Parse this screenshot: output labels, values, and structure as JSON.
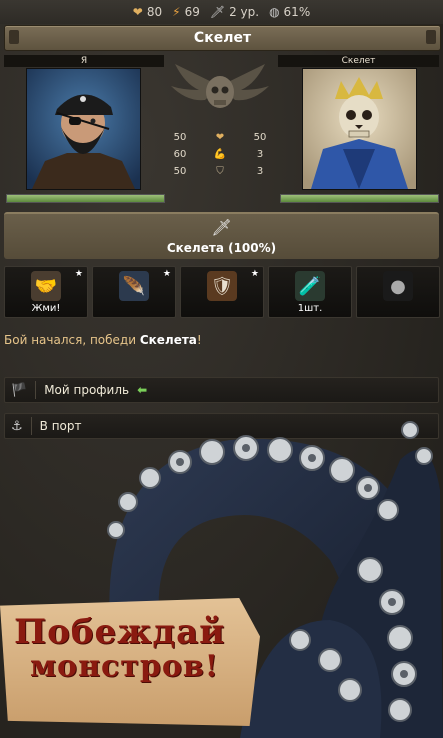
{
  "stats": {
    "health": "80",
    "energy": "69",
    "level": "2 ур.",
    "progress": "61%"
  },
  "title": "Скелет",
  "player": {
    "name": "Я",
    "health_fraction": 1.0
  },
  "enemy": {
    "name": "Скелет",
    "health_fraction": 1.0
  },
  "comparison": {
    "rows": [
      {
        "icon": "heart-icon",
        "player": "50",
        "enemy": "50"
      },
      {
        "icon": "strength-icon",
        "player": "60",
        "enemy": "3"
      },
      {
        "icon": "shield-icon",
        "player": "50",
        "enemy": "3"
      }
    ]
  },
  "attack": {
    "label": "Скелета (100%)"
  },
  "skills": [
    {
      "icon": "handshake-icon",
      "caption": "Жми!",
      "starred": true
    },
    {
      "icon": "feather-icon",
      "caption": "",
      "starred": true
    },
    {
      "icon": "shield-emblem-icon",
      "caption": "",
      "starred": true
    },
    {
      "icon": "potion-bottle-icon",
      "caption": "1шт.",
      "starred": false
    },
    {
      "icon": "bomb-icon",
      "caption": "",
      "starred": false
    }
  ],
  "message": {
    "prefix": "Бой начался, победи ",
    "target": "Скелета",
    "suffix": "!"
  },
  "nav": {
    "profile": "Мой профиль",
    "port": "В порт"
  },
  "banner": {
    "line1": "Побеждай",
    "line2": "монстров!"
  },
  "colors": {
    "accent_gold": "#e6c48a",
    "hp_green": "#7fa85a",
    "banner_red": "#8a1a10"
  }
}
